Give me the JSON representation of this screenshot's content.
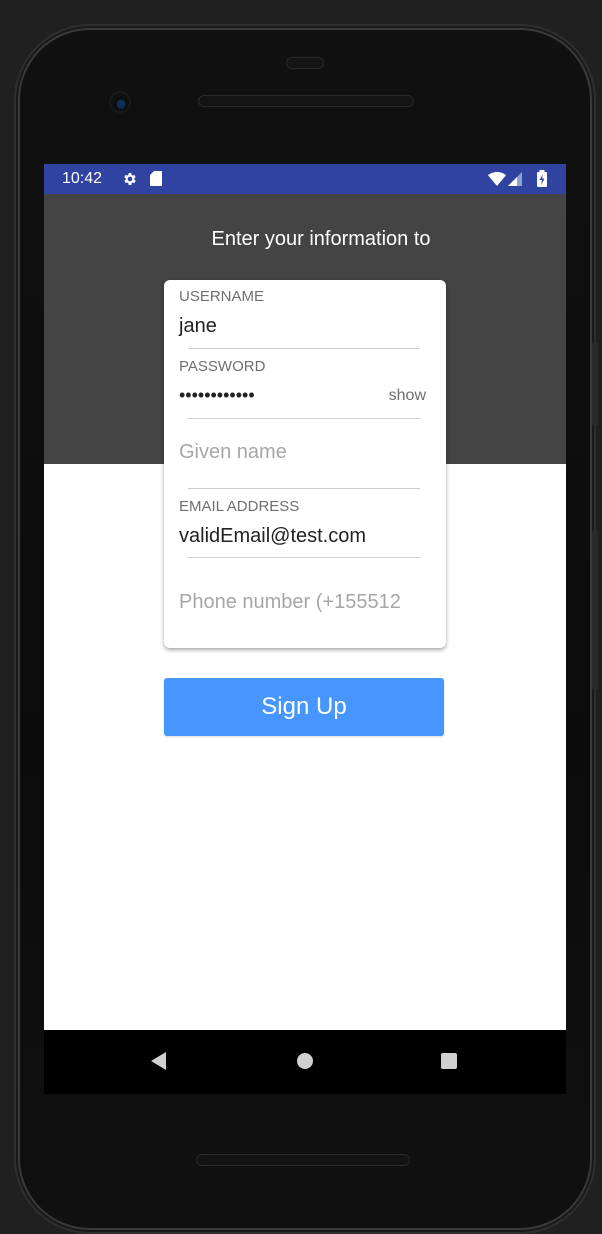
{
  "status_bar": {
    "time": "10:42",
    "icons": [
      "settings-gear-icon",
      "sd-card-icon",
      "wifi-icon",
      "cell-signal-icon",
      "battery-charging-icon"
    ],
    "color": "#3043a0"
  },
  "header": {
    "title": "Enter your information to",
    "background": "#444444"
  },
  "form": {
    "username": {
      "label": "USERNAME",
      "value": "jane"
    },
    "password": {
      "label": "PASSWORD",
      "masked_value": "••••••••••••",
      "toggle_label": "show"
    },
    "given_name": {
      "placeholder": "Given name"
    },
    "email": {
      "label": "EMAIL ADDRESS",
      "value": "validEmail@test.com"
    },
    "phone": {
      "placeholder": "Phone number (+155512"
    }
  },
  "actions": {
    "signup_label": "Sign Up",
    "accent": "#4795ff"
  },
  "nav_bar": {
    "icons": [
      "back-icon",
      "home-icon",
      "recent-apps-icon"
    ]
  }
}
